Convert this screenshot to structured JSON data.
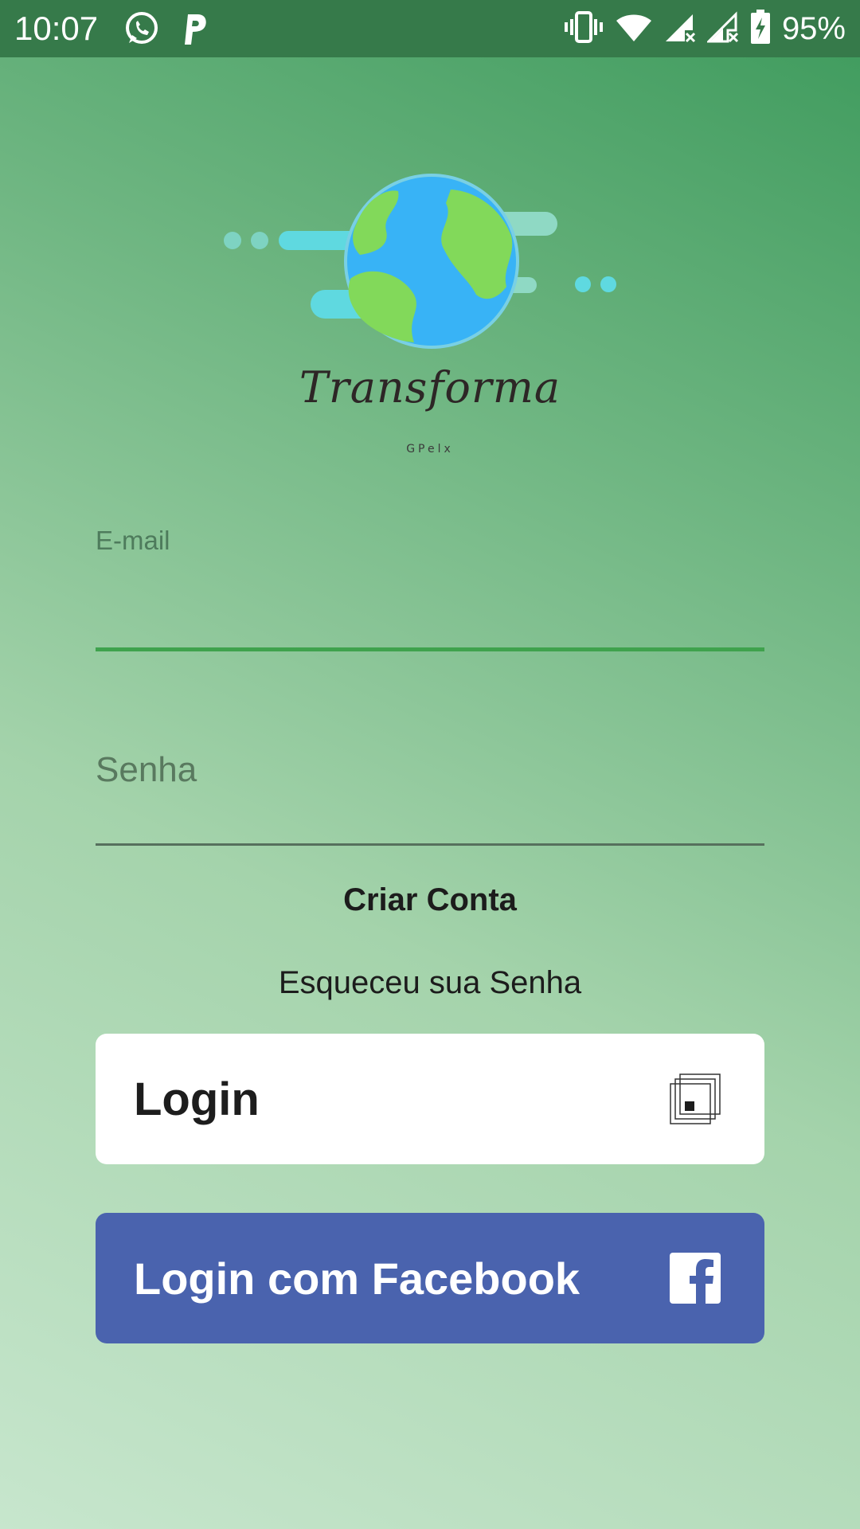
{
  "status_bar": {
    "time": "10:07",
    "battery": "95%",
    "icons": [
      "whatsapp-icon",
      "parking-p-icon",
      "vibrate-icon",
      "wifi-icon",
      "signal-icon",
      "signal-icon",
      "battery-charging-icon"
    ]
  },
  "logo": {
    "wordmark": "Transforma",
    "subtitle": "GPelx"
  },
  "form": {
    "email_label": "E-mail",
    "email_value": "",
    "password_placeholder": "Senha",
    "create_account": "Criar Conta",
    "forgot_password": "Esqueceu sua Senha"
  },
  "buttons": {
    "login": "Login",
    "facebook": "Login com Facebook"
  },
  "colors": {
    "accent_green": "#3fa24d",
    "facebook_blue": "#4a63ae",
    "status_bar": "#367a4a"
  }
}
